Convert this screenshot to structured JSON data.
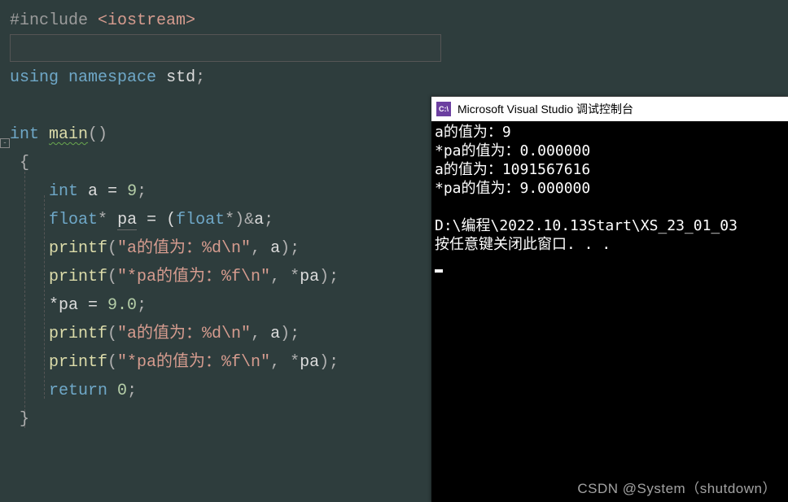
{
  "code": {
    "l1_pre": "#include ",
    "l1_path": "<iostream>",
    "l3_kw1": "using",
    "l3_kw2": "namespace",
    "l3_ns": "std",
    "l3_semi": ";",
    "l5_type": "int",
    "l5_fn": "main",
    "l5_par": "()",
    "l6_brace": "{",
    "l7_type": "int",
    "l7_ident": "a",
    "l7_eq": " = ",
    "l7_num": "9",
    "l7_semi": ";",
    "l8_type": "float",
    "l8_star": "*",
    "l8_ident": "pa",
    "l8_eq": " = (",
    "l8_cast": "float",
    "l8_castend": "*)&",
    "l8_var": "a",
    "l8_semi": ";",
    "l9_fn": "printf",
    "l9_open": "(",
    "l9_str": "\"a的值为：%d\\n\"",
    "l9_comma": ", ",
    "l9_arg": "a",
    "l9_close": ");",
    "l10_fn": "printf",
    "l10_open": "(",
    "l10_str": "\"*pa的值为：%f\\n\"",
    "l10_comma": ", *",
    "l10_arg": "pa",
    "l10_close": ");",
    "l11_lhs": "*pa",
    "l11_eq": " = ",
    "l11_num": "9.0",
    "l11_semi": ";",
    "l12_fn": "printf",
    "l12_open": "(",
    "l12_str": "\"a的值为：%d\\n\"",
    "l12_comma": ", ",
    "l12_arg": "a",
    "l12_close": ");",
    "l13_fn": "printf",
    "l13_open": "(",
    "l13_str": "\"*pa的值为：%f\\n\"",
    "l13_comma": ", *",
    "l13_arg": "pa",
    "l13_close": ");",
    "l14_kw": "return",
    "l14_sp": " ",
    "l14_num": "0",
    "l14_semi": ";",
    "l15_brace": "}"
  },
  "console": {
    "title_prefix": "C:\\",
    "title": "Microsoft Visual Studio 调试控制台",
    "l1": "a的值为：9",
    "l2": "*pa的值为：0.000000",
    "l3": "a的值为：1091567616",
    "l4": "*pa的值为：9.000000",
    "blank": " ",
    "path": "D:\\编程\\2022.10.13Start\\XS_23_01_03",
    "prompt": "按任意键关闭此窗口. . ."
  },
  "watermark": "CSDN @System（shutdown）"
}
